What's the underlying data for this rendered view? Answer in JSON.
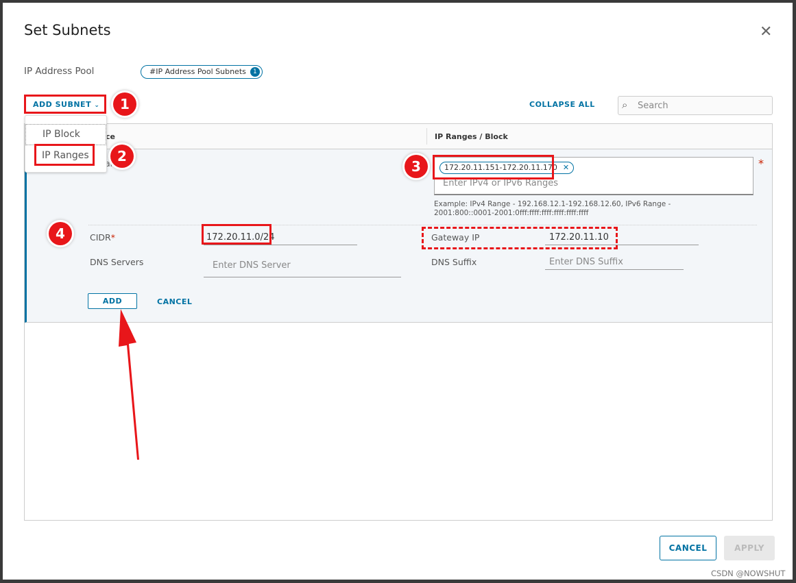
{
  "dialog": {
    "title": "Set Subnets",
    "close_icon": "close-icon"
  },
  "pool": {
    "label": "IP Address Pool",
    "chip": "#IP Address Pool Subnets",
    "chip_count": "1"
  },
  "toolbar": {
    "add_subnet": "ADD SUBNET",
    "collapse_all": "COLLAPSE ALL",
    "search_placeholder": "Search"
  },
  "dropdown": {
    "items": [
      "IP Block",
      "IP Ranges"
    ]
  },
  "table": {
    "col1_fragment": "ce",
    "col2": "IP Ranges / Block",
    "row_fragment": "ar"
  },
  "form": {
    "range_chip": "172.20.11.151-172.20.11.170",
    "range_placeholder": "Enter IPv4 or IPv6 Ranges",
    "example": "Example: IPv4 Range - 192.168.12.1-192.168.12.60, IPv6 Range - 2001:800::0001-2001:0fff:ffff:ffff:ffff:ffff:ffff",
    "cidr_label": "CIDR",
    "cidr_value": "172.20.11.0/24",
    "gateway_label": "Gateway IP",
    "gateway_value": "172.20.11.10",
    "dns_servers_label": "DNS Servers",
    "dns_servers_placeholder": "Enter DNS Server",
    "dns_suffix_label": "DNS Suffix",
    "dns_suffix_placeholder": "Enter DNS Suffix",
    "add": "ADD",
    "cancel": "CANCEL",
    "required": "*"
  },
  "footer": {
    "cancel": "CANCEL",
    "apply": "APPLY"
  },
  "annotations": [
    "1",
    "2",
    "3",
    "4"
  ],
  "watermark": "CSDN @NOWSHUT",
  "colors": {
    "accent": "#0072a3",
    "annotation": "#e8161a"
  }
}
